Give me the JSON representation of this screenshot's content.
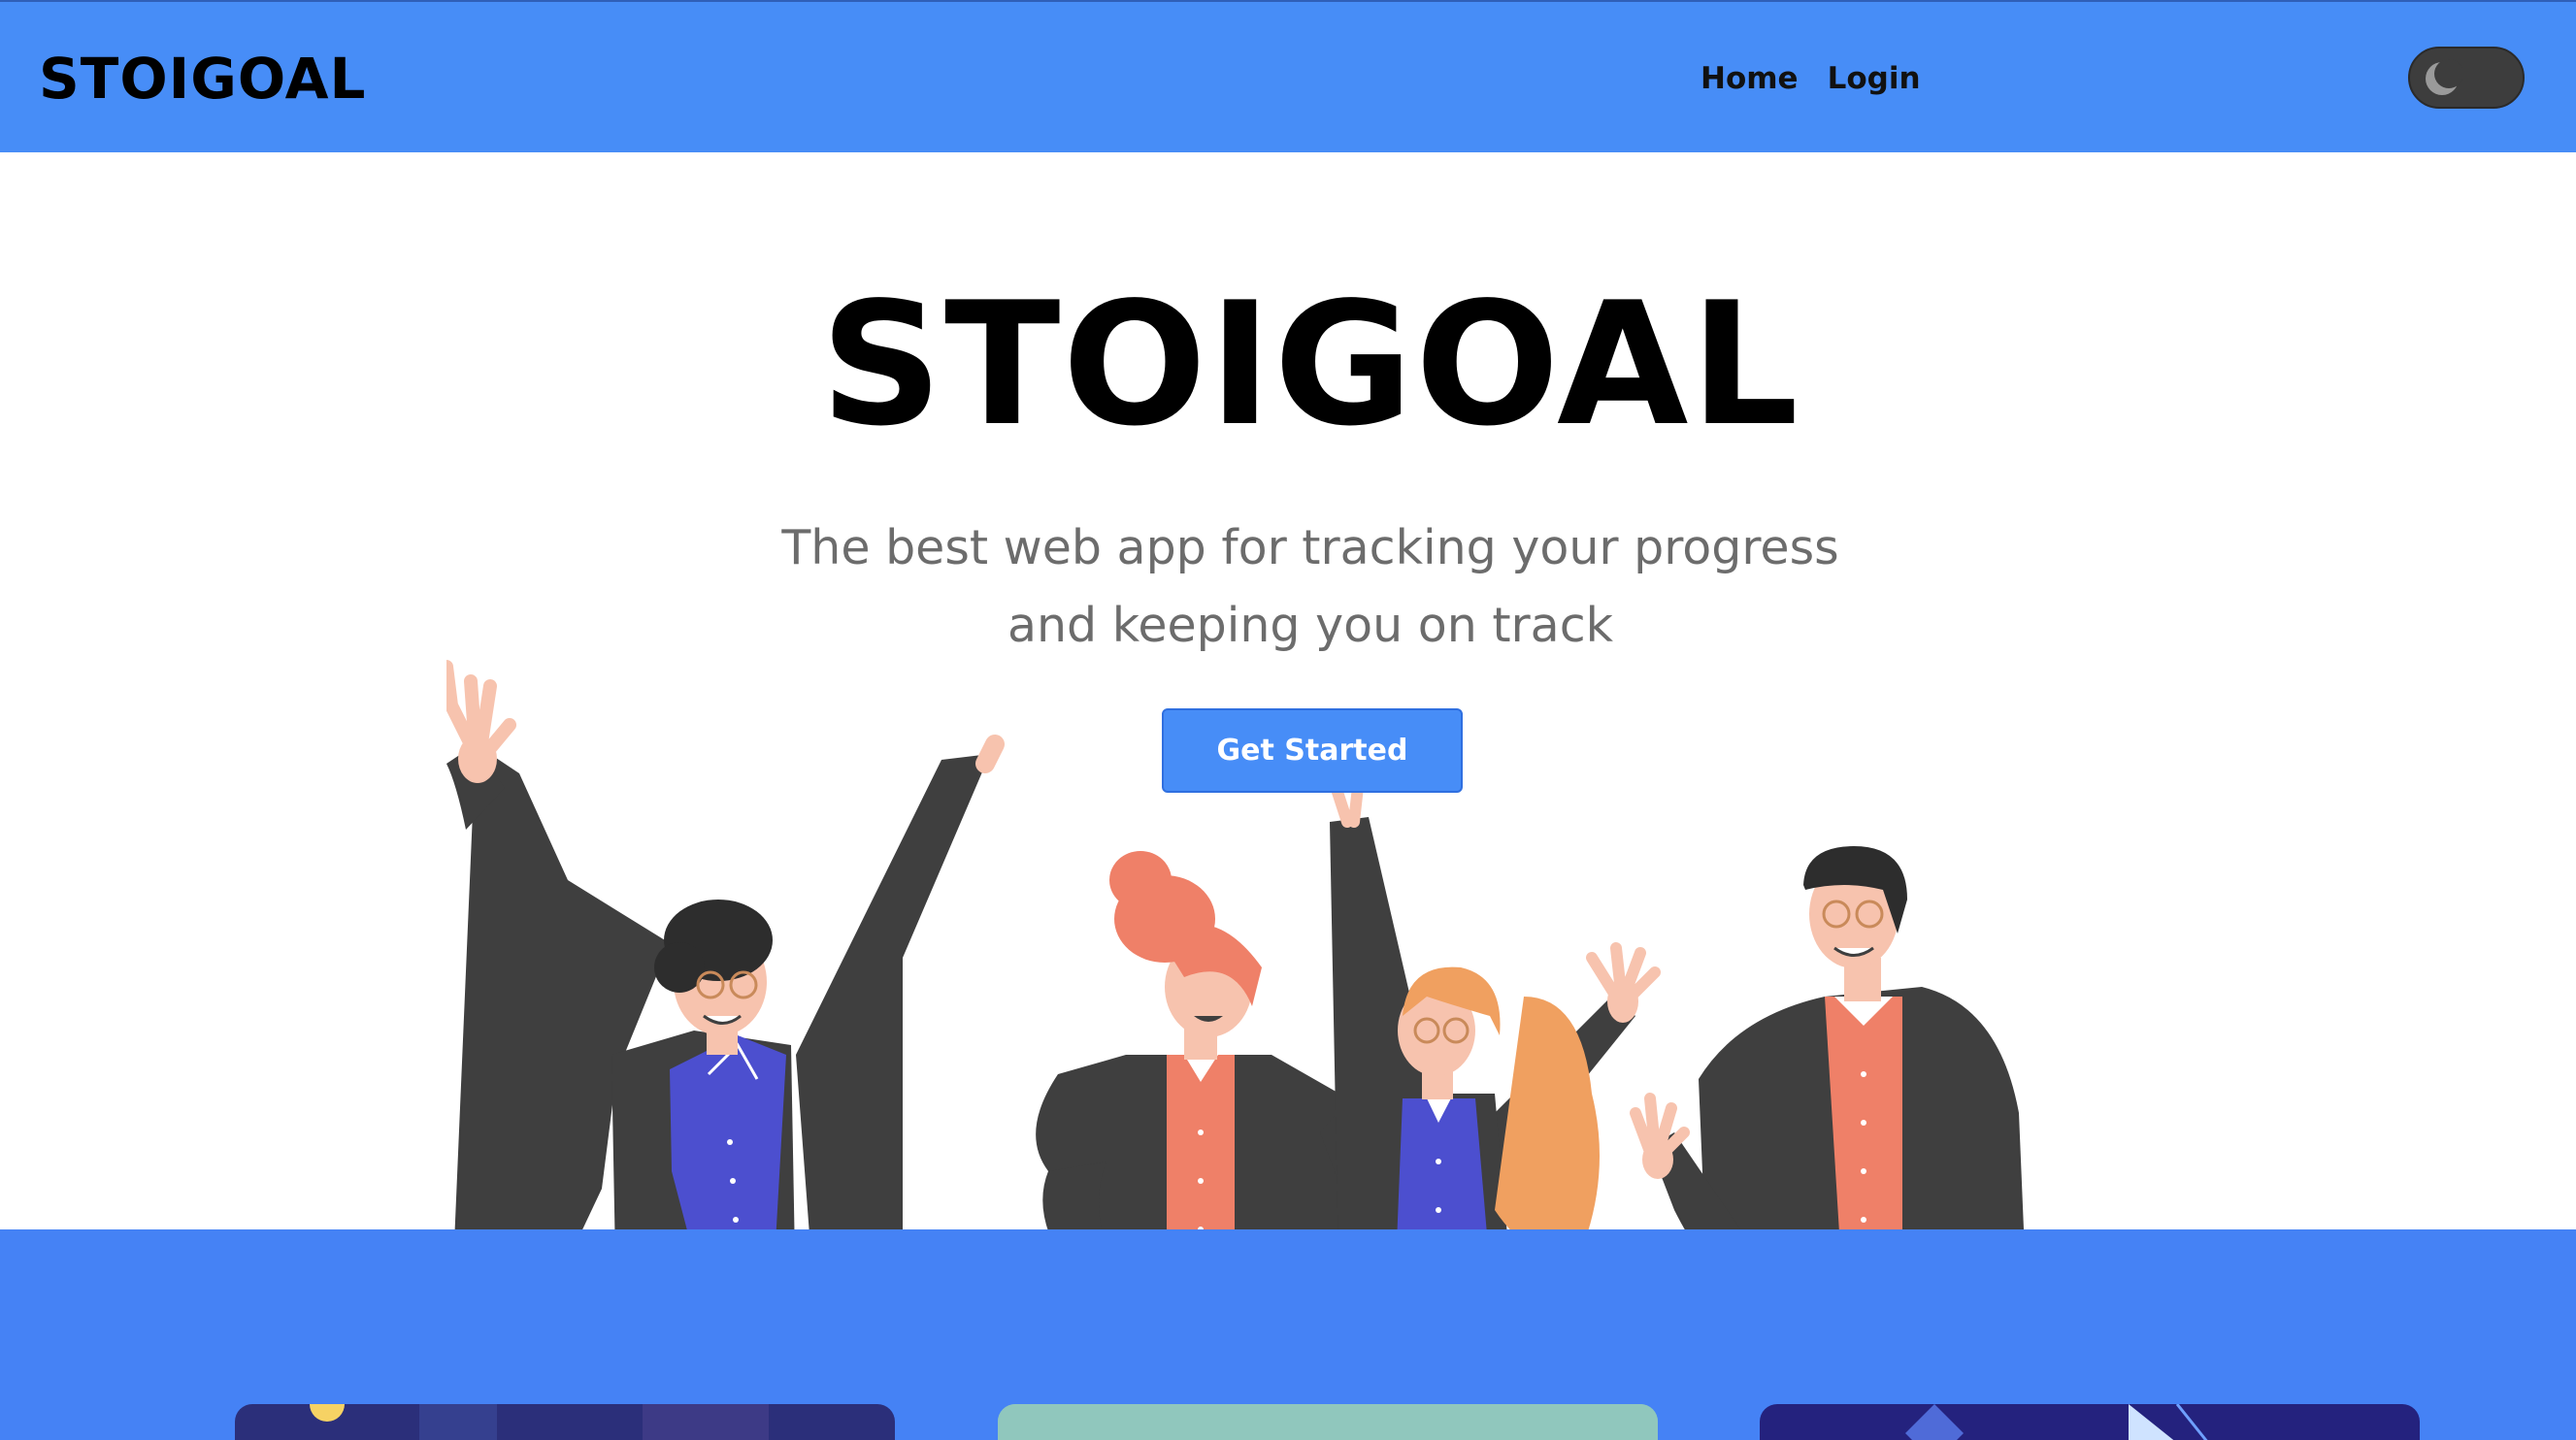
{
  "navbar": {
    "brand": "STOIGOAL",
    "links": [
      {
        "label": "Home"
      },
      {
        "label": "Login"
      }
    ],
    "theme_toggle": {
      "icon": "moon-icon",
      "state": "dark"
    }
  },
  "hero": {
    "title": "STOIGOAL",
    "subtitle_line1": "The best web app for tracking your progress",
    "subtitle_line2": "and keeping you on track",
    "cta_label": "Get Started",
    "illustration": "people-celebrating-illustration"
  },
  "features": {
    "cards": [
      {
        "image": "feature-card-1-image"
      },
      {
        "image": "feature-card-2-image"
      },
      {
        "image": "feature-card-3-image"
      }
    ]
  },
  "colors": {
    "primary": "#478df7",
    "band": "#4582f5",
    "dark": "#3f3f3f",
    "shirt_blue": "#4c4fcf",
    "shirt_coral": "#ef8068",
    "hair_orange": "#f0a060",
    "skin": "#f7c3ae"
  }
}
